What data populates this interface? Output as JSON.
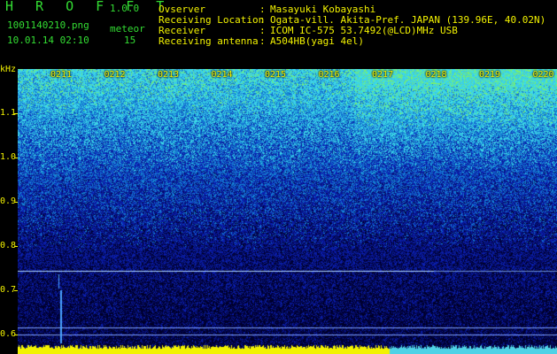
{
  "app": {
    "brand": "H R O F F T",
    "version": "1.0.0"
  },
  "file": {
    "name": "1001140210.png",
    "datetime": "10.01.14 02:10"
  },
  "counter": {
    "label": "meteor",
    "value": "15"
  },
  "station": [
    {
      "key": "Ovserver",
      "value": "Masayuki Kobayashi"
    },
    {
      "key": "Receiving Location",
      "value": "Ogata-vill. Akita-Pref. JAPAN (139.96E, 40.02N)"
    },
    {
      "key": "Receiver",
      "value": "ICOM IC-575 53.7492(@LCD)MHz USB"
    },
    {
      "key": "Receiving antenna",
      "value": "A504HB(yagi 4el)"
    }
  ],
  "spectrogram": {
    "y_unit": "kHz",
    "y_ticks": [
      "1.1",
      "1.0",
      "0.9",
      "0.8",
      "0.7",
      "0.6"
    ],
    "x_ticks": [
      "0211",
      "0212",
      "0213",
      "0214",
      "0215",
      "0216",
      "0217",
      "0218",
      "0219",
      "0220"
    ],
    "colors": {
      "background": "#000000",
      "low": "#0a1a8a",
      "mid": "#1e6ed8",
      "high": "#4fd2e6",
      "peak": "#7bf07b",
      "text": "#f2f200",
      "title": "#33dd33"
    }
  }
}
